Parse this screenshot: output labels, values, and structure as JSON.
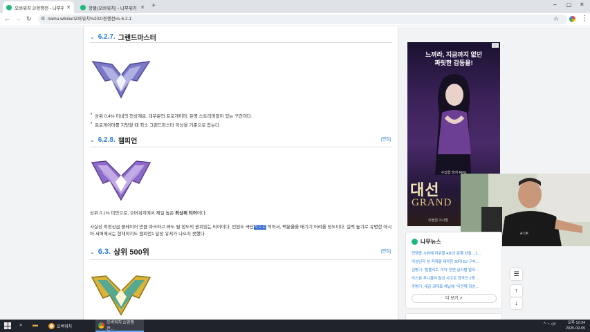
{
  "browser": {
    "tabs": [
      {
        "title": "오버워치 2/경쟁전 - 나무위키",
        "active": true
      },
      {
        "title": "광물(오버워치) - 나무위키",
        "active": false
      }
    ],
    "new_tab": "+",
    "url": "namu.wiki/w/오버워치%202/경쟁전#s-6.2.1",
    "window_controls": {
      "minimize": "–",
      "maximize": "▢",
      "close": "✕"
    }
  },
  "article": {
    "cut_heading": {
      "number": "6.2.7.",
      "title": "그랜드마스터"
    },
    "grandmaster_bullets": [
      "상위 0.4% 이내의 천상계로, 대부분의 프로게이머, 유명 스트리머들이 있는 구간이다.",
      "프로게이머를 지망할 때 최소 그랜드마스터 이상을 기준으로 잡는다."
    ],
    "champion": {
      "number": "6.2.8.",
      "title": "챔피언",
      "edit": "[편집]",
      "line1_before": "상위 0.1% 미만으로, 오버워치에서 제일 높은 ",
      "line1_bold": "최상위 티어",
      "line1_after": "이다.",
      "para2_before": "사실상 최정상급 플레이어 만큼 마크하고 봐도 될 정도의 권위있는 티어이다. 인원도 극단",
      "para2_highlight": "적으로",
      "para2_after": " 적어서, 백분율을 매기기 어려울 정도이다. 실력 높기로 유명한 아시아 서버에서는 현재까지도 챔피언1 달성 유저가 나오지 못했다."
    },
    "top500": {
      "number": "6.3.",
      "title": "상위 500위",
      "edit": "[편집]"
    }
  },
  "sidebar": {
    "ad": {
      "headline_line1": "느껴라, 지금까지 없던",
      "headline_line2": "짜릿한 감동을!",
      "subtitle": "수집형 방치 RPG",
      "big_text": "대선",
      "grand_text": "GRAND",
      "footnote": "파블캠 이사별"
    },
    "news": {
      "title": "나무뉴스",
      "items": [
        "전쟁중 시위에 자위할 4호선 운행 차질…1…",
        "미성년자 성 착취물 제작한 30대 BJ 구속…",
        "김병기, '합플리트 가치' 전면 금지법 발의…",
        "리스본 푸니쿨라 탈선 사고로 한국인 2명 …",
        "주병기, 세금·과태료 체납에 \"국민께 죄송…"
      ],
      "more": "더 보기 ↗"
    }
  },
  "float_buttons": {
    "toc": "☰",
    "up": "↑",
    "down": "↓"
  },
  "taskbar": {
    "apps": [
      {
        "label": "오버워치",
        "active": false
      },
      {
        "label": "오버워치 2/경쟁전...",
        "active": true
      }
    ],
    "clock_time": "오후 12:34",
    "clock_date": "2025-09-05",
    "tray": "^ ◔ ◁×"
  }
}
